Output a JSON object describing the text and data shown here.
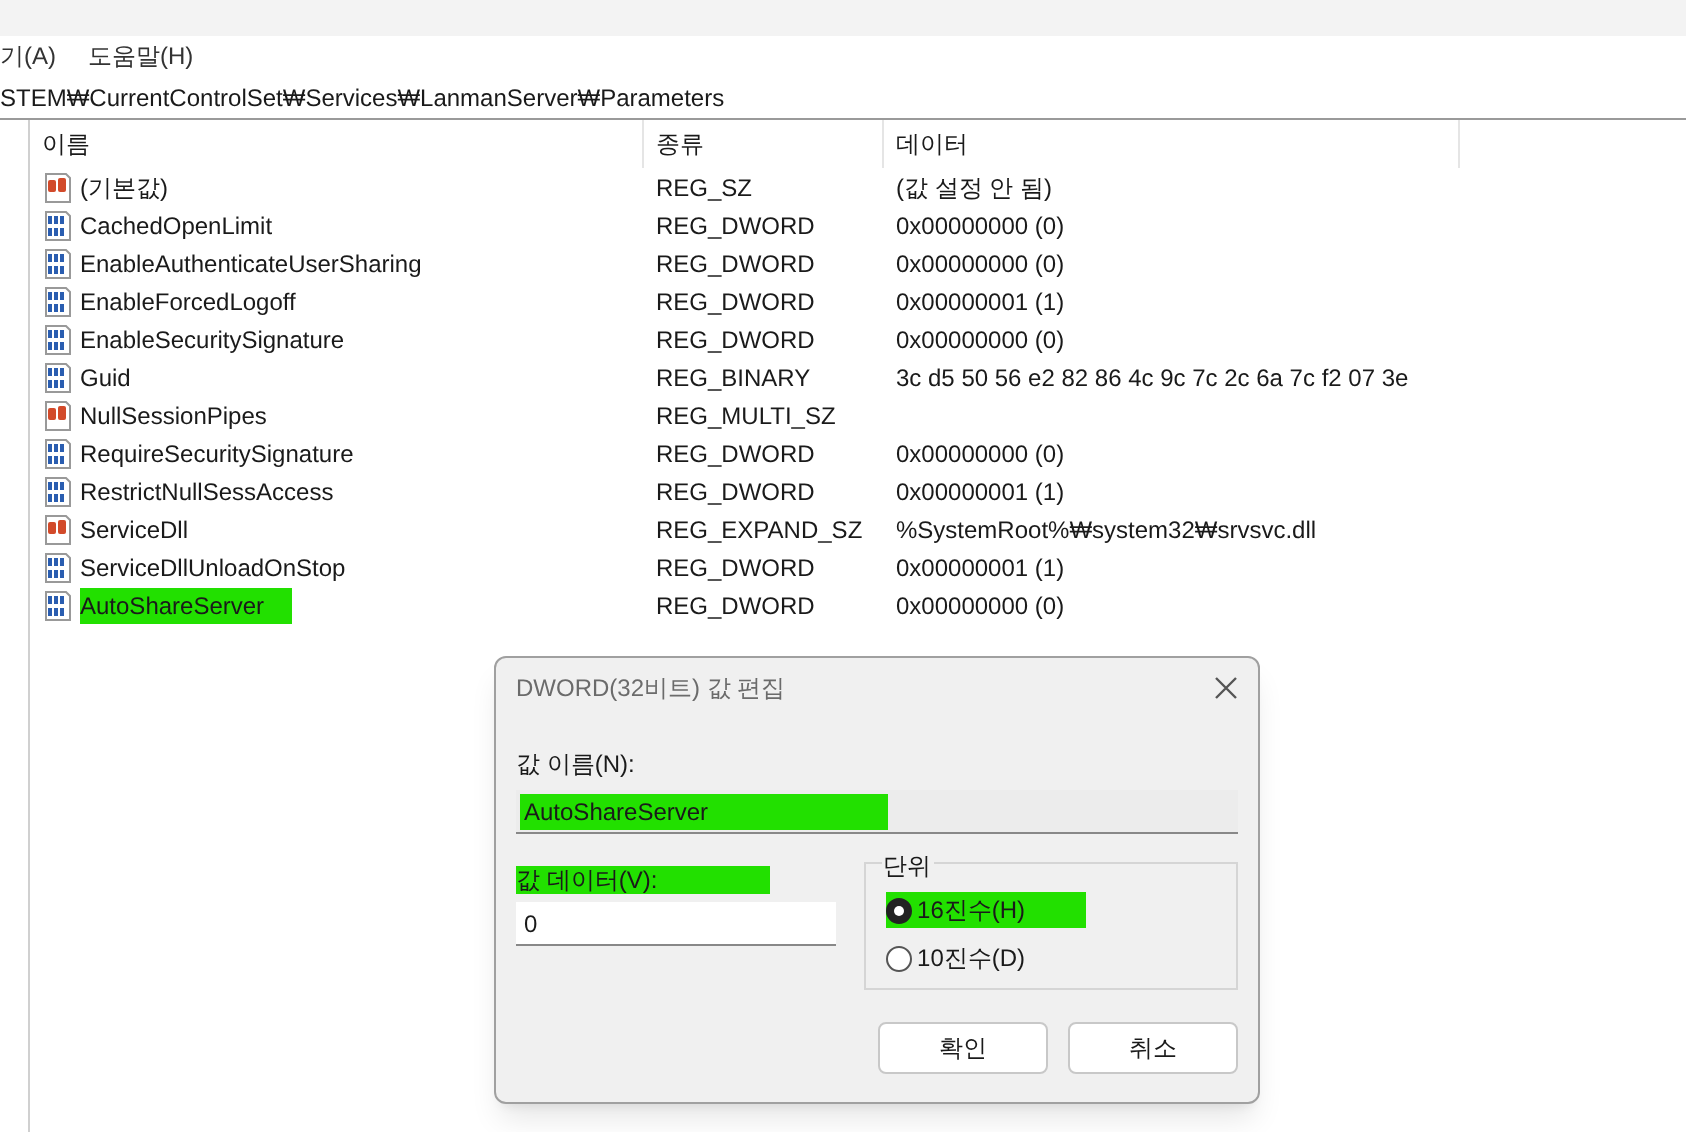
{
  "menu": [
    {
      "label": "기(A)"
    },
    {
      "label": "도움말(H)"
    }
  ],
  "address": "STEM₩CurrentControlSet₩Services₩LanmanServer₩Parameters",
  "table": {
    "columns": [
      "이름",
      "종류",
      "데이터"
    ],
    "rows": [
      {
        "kind": "string",
        "name": "(기본값)",
        "type": "REG_SZ",
        "data": "(값 설정 안 됨)",
        "highlighted": false
      },
      {
        "kind": "binary",
        "name": "CachedOpenLimit",
        "type": "REG_DWORD",
        "data": "0x00000000 (0)",
        "highlighted": false
      },
      {
        "kind": "binary",
        "name": "EnableAuthenticateUserSharing",
        "type": "REG_DWORD",
        "data": "0x00000000 (0)",
        "highlighted": false
      },
      {
        "kind": "binary",
        "name": "EnableForcedLogoff",
        "type": "REG_DWORD",
        "data": "0x00000001 (1)",
        "highlighted": false
      },
      {
        "kind": "binary",
        "name": "EnableSecuritySignature",
        "type": "REG_DWORD",
        "data": "0x00000000 (0)",
        "highlighted": false
      },
      {
        "kind": "binary",
        "name": "Guid",
        "type": "REG_BINARY",
        "data": "3c d5 50 56 e2 82 86 4c 9c 7c 2c 6a 7c f2 07 3e",
        "highlighted": false
      },
      {
        "kind": "string",
        "name": "NullSessionPipes",
        "type": "REG_MULTI_SZ",
        "highlighted": false
      },
      {
        "kind": "binary",
        "name": "RequireSecuritySignature",
        "type": "REG_DWORD",
        "data": "0x00000000 (0)",
        "highlighted": false
      },
      {
        "kind": "binary",
        "name": "RestrictNullSessAccess",
        "type": "REG_DWORD",
        "data": "0x00000001 (1)",
        "highlighted": false
      },
      {
        "kind": "string",
        "name": "ServiceDll",
        "type": "REG_EXPAND_SZ",
        "data": "%SystemRoot%₩system32₩srvsvc.dll",
        "highlighted": false
      },
      {
        "kind": "binary",
        "name": "ServiceDllUnloadOnStop",
        "type": "REG_DWORD",
        "data": "0x00000001 (1)",
        "highlighted": false
      },
      {
        "kind": "binary",
        "name": "AutoShareServer",
        "type": "REG_DWORD",
        "data": "0x00000000 (0)",
        "highlighted": true
      }
    ]
  },
  "dialog": {
    "title": "DWORD(32비트) 값 편집",
    "name_label": "값 이름(N):",
    "name_value": "AutoShareServer",
    "name_highlighted": true,
    "data_label": "값 데이터(V):",
    "data_label_highlighted": true,
    "data_value": "0",
    "base_group": "단위",
    "bases": [
      {
        "label": "16진수(H)",
        "selected": true,
        "highlighted": true
      },
      {
        "label": "10진수(D)",
        "selected": false,
        "highlighted": false
      }
    ],
    "buttons": [
      "확인",
      "취소"
    ]
  }
}
